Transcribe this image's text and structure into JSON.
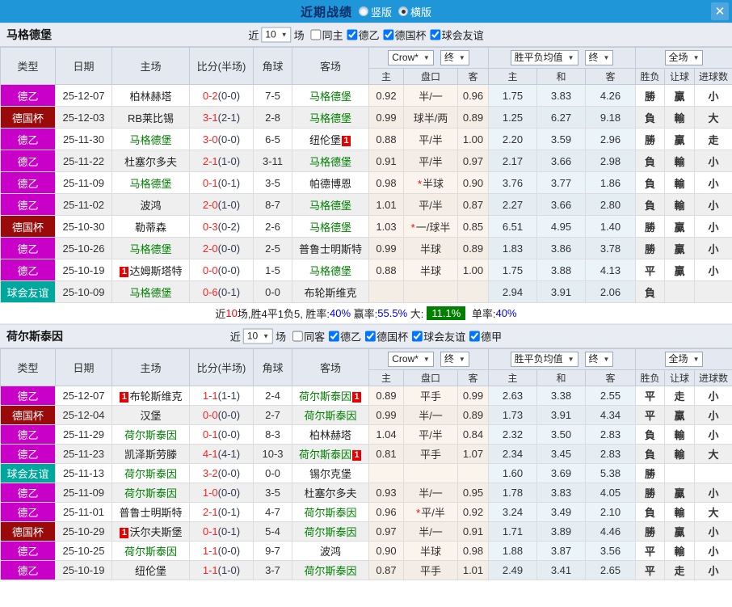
{
  "titlebar": {
    "title": "近期战绩",
    "radios": [
      {
        "label": "竖版",
        "checked": false
      },
      {
        "label": "横版",
        "checked": true
      }
    ]
  },
  "icons": {
    "close": "✕",
    "dropdown_arrow": "▼",
    "rank_badge": "1"
  },
  "table_header": {
    "type": "类型",
    "date": "日期",
    "home": "主场",
    "score": "比分(半场)",
    "corner": "角球",
    "away": "客场",
    "odds_source": "Crow*",
    "odds_period": "终",
    "avg_source": "胜平负均值",
    "avg_period": "终",
    "result_scope": "全场",
    "odds_home": "主",
    "odds_handicap": "盘口",
    "odds_away": "客",
    "avg_home": "主",
    "avg_draw": "和",
    "avg_away": "客",
    "result_wl": "胜负",
    "result_handicap": "让球",
    "result_goals": "进球数"
  },
  "colors": {
    "league_de2": "#C800C8",
    "cup": "#9A0A0A",
    "friendly": "#00A79C",
    "self_team": "#008000",
    "win": "#D40000",
    "lose": "#007A00",
    "draw": "#1414CC",
    "score_red": "#FF2222",
    "summary_highlight_bg": "#008000",
    "titlebar_blue": "#1E96D8"
  },
  "sections": [
    {
      "team": "马格德堡",
      "filter": {
        "prefix": "近",
        "count": "10",
        "suffix": "场",
        "checkboxes": [
          {
            "label": "同主",
            "checked": false
          },
          {
            "label": "德乙",
            "checked": true
          },
          {
            "label": "德国杯",
            "checked": true
          },
          {
            "label": "球会友谊",
            "checked": true
          }
        ]
      },
      "rows": [
        {
          "type": "德乙",
          "tc": "league",
          "date": "25-12-07",
          "home": "柏林赫塔",
          "score": "0-2",
          "half": "(0-0)",
          "corner": "7-5",
          "away": "马格德堡",
          "as": true,
          "h": "0.92",
          "hcap": "半/一",
          "a": "0.96",
          "m1": "1.75",
          "m2": "3.83",
          "m3": "4.26",
          "wl": "勝",
          "wlc": "r",
          "rg": "贏",
          "rgc": "r",
          "big": "小",
          "bigc": "g"
        },
        {
          "type": "德国杯",
          "tc": "cup",
          "date": "25-12-03",
          "home": "RB莱比锡",
          "score": "3-1",
          "half": "(2-1)",
          "corner": "2-8",
          "away": "马格德堡",
          "as": true,
          "h": "0.99",
          "hcap": "球半/两",
          "a": "0.89",
          "m1": "1.25",
          "m2": "6.27",
          "m3": "9.18",
          "wl": "負",
          "wlc": "g",
          "rg": "輸",
          "rgc": "g",
          "big": "大",
          "bigc": "r"
        },
        {
          "type": "德乙",
          "tc": "league",
          "date": "25-11-30",
          "home": "马格德堡",
          "hs": true,
          "score": "3-0",
          "half": "(0-0)",
          "corner": "6-5",
          "away": "纽伦堡",
          "ab": "1",
          "h": "0.88",
          "hcap": "平/半",
          "a": "1.00",
          "m1": "2.20",
          "m2": "3.59",
          "m3": "2.96",
          "wl": "勝",
          "wlc": "r",
          "rg": "贏",
          "rgc": "r",
          "big": "走",
          "bigc": "b"
        },
        {
          "type": "德乙",
          "tc": "league",
          "date": "25-11-22",
          "home": "杜塞尔多夫",
          "score": "2-1",
          "half": "(1-0)",
          "corner": "3-11",
          "away": "马格德堡",
          "as": true,
          "h": "0.91",
          "hcap": "平/半",
          "a": "0.97",
          "m1": "2.17",
          "m2": "3.66",
          "m3": "2.98",
          "wl": "負",
          "wlc": "g",
          "rg": "輸",
          "rgc": "g",
          "big": "小",
          "bigc": "g"
        },
        {
          "type": "德乙",
          "tc": "league",
          "date": "25-11-09",
          "home": "马格德堡",
          "hs": true,
          "score": "0-1",
          "half": "(0-1)",
          "corner": "3-5",
          "away": "帕德博恩",
          "h": "0.98",
          "hcap": "半球",
          "star": true,
          "a": "0.90",
          "m1": "3.76",
          "m2": "3.77",
          "m3": "1.86",
          "wl": "負",
          "wlc": "g",
          "rg": "輸",
          "rgc": "g",
          "big": "小",
          "bigc": "g"
        },
        {
          "type": "德乙",
          "tc": "league",
          "date": "25-11-02",
          "home": "波鸿",
          "score": "2-0",
          "half": "(1-0)",
          "corner": "8-7",
          "away": "马格德堡",
          "as": true,
          "h": "1.01",
          "hcap": "平/半",
          "a": "0.87",
          "m1": "2.27",
          "m2": "3.66",
          "m3": "2.80",
          "wl": "負",
          "wlc": "g",
          "rg": "輸",
          "rgc": "g",
          "big": "小",
          "bigc": "g"
        },
        {
          "type": "德国杯",
          "tc": "cup",
          "date": "25-10-30",
          "home": "勒蒂森",
          "score": "0-3",
          "half": "(0-2)",
          "corner": "2-6",
          "away": "马格德堡",
          "as": true,
          "h": "1.03",
          "hcap": "一/球半",
          "star": true,
          "a": "0.85",
          "m1": "6.51",
          "m2": "4.95",
          "m3": "1.40",
          "wl": "勝",
          "wlc": "r",
          "rg": "贏",
          "rgc": "r",
          "big": "小",
          "bigc": "g"
        },
        {
          "type": "德乙",
          "tc": "league",
          "date": "25-10-26",
          "home": "马格德堡",
          "hs": true,
          "score": "2-0",
          "half": "(0-0)",
          "corner": "2-5",
          "away": "普鲁士明斯特",
          "h": "0.99",
          "hcap": "半球",
          "a": "0.89",
          "m1": "1.83",
          "m2": "3.86",
          "m3": "3.78",
          "wl": "勝",
          "wlc": "r",
          "rg": "贏",
          "rgc": "r",
          "big": "小",
          "bigc": "g"
        },
        {
          "type": "德乙",
          "tc": "league",
          "date": "25-10-19",
          "home": "达姆斯塔特",
          "hb": "1",
          "score": "0-0",
          "half": "(0-0)",
          "corner": "1-5",
          "away": "马格德堡",
          "as": true,
          "h": "0.88",
          "hcap": "半球",
          "a": "1.00",
          "m1": "1.75",
          "m2": "3.88",
          "m3": "4.13",
          "wl": "平",
          "wlc": "b",
          "rg": "贏",
          "rgc": "r",
          "big": "小",
          "bigc": "g"
        },
        {
          "type": "球会友谊",
          "tc": "friendly",
          "date": "25-10-09",
          "home": "马格德堡",
          "hs": true,
          "score": "0-6",
          "half": "(0-1)",
          "corner": "0-0",
          "away": "布轮斯维克",
          "h": "",
          "hcap": "",
          "a": "",
          "m1": "2.94",
          "m2": "3.91",
          "m3": "2.06",
          "wl": "負",
          "wlc": "g",
          "rg": "",
          "big": ""
        }
      ],
      "summary": {
        "s1": "近",
        "count": "10",
        "s2": "场,胜4平1负5, 胜率:",
        "win_rate": "40%",
        "s3": " 赢率:",
        "odds_rate": "55.5%",
        "s4": " 大:",
        "big_rate": "11.1%",
        "s5": " 单率:",
        "single_rate": "40%"
      }
    },
    {
      "team": "荷尔斯泰因",
      "filter": {
        "prefix": "近",
        "count": "10",
        "suffix": "场",
        "checkboxes": [
          {
            "label": "同客",
            "checked": false
          },
          {
            "label": "德乙",
            "checked": true
          },
          {
            "label": "德国杯",
            "checked": true
          },
          {
            "label": "球会友谊",
            "checked": true
          },
          {
            "label": "德甲",
            "checked": true
          }
        ]
      },
      "rows": [
        {
          "type": "德乙",
          "tc": "league",
          "date": "25-12-07",
          "home": "布轮斯维克",
          "hb": "1",
          "score": "1-1",
          "half": "(1-1)",
          "corner": "2-4",
          "away": "荷尔斯泰因",
          "as": true,
          "ab": "1",
          "h": "0.89",
          "hcap": "平手",
          "a": "0.99",
          "m1": "2.63",
          "m2": "3.38",
          "m3": "2.55",
          "wl": "平",
          "wlc": "b",
          "rg": "走",
          "rgc": "b",
          "big": "小",
          "bigc": "g"
        },
        {
          "type": "德国杯",
          "tc": "cup",
          "date": "25-12-04",
          "home": "汉堡",
          "score": "0-0",
          "half": "(0-0)",
          "corner": "2-7",
          "away": "荷尔斯泰因",
          "as": true,
          "h": "0.99",
          "hcap": "半/一",
          "a": "0.89",
          "m1": "1.73",
          "m2": "3.91",
          "m3": "4.34",
          "wl": "平",
          "wlc": "b",
          "rg": "贏",
          "rgc": "r",
          "big": "小",
          "bigc": "g"
        },
        {
          "type": "德乙",
          "tc": "league",
          "date": "25-11-29",
          "home": "荷尔斯泰因",
          "hs": true,
          "score": "0-1",
          "half": "(0-0)",
          "corner": "8-3",
          "away": "柏林赫塔",
          "h": "1.04",
          "hcap": "平/半",
          "a": "0.84",
          "m1": "2.32",
          "m2": "3.50",
          "m3": "2.83",
          "wl": "負",
          "wlc": "g",
          "rg": "輸",
          "rgc": "g",
          "big": "小",
          "bigc": "g"
        },
        {
          "type": "德乙",
          "tc": "league",
          "date": "25-11-23",
          "home": "凯泽斯劳滕",
          "score": "4-1",
          "half": "(4-1)",
          "corner": "10-3",
          "away": "荷尔斯泰因",
          "as": true,
          "ab": "1",
          "h": "0.81",
          "hcap": "平手",
          "a": "1.07",
          "m1": "2.34",
          "m2": "3.45",
          "m3": "2.83",
          "wl": "負",
          "wlc": "g",
          "rg": "輸",
          "rgc": "g",
          "big": "大",
          "bigc": "r"
        },
        {
          "type": "球会友谊",
          "tc": "friendly",
          "date": "25-11-13",
          "home": "荷尔斯泰因",
          "hs": true,
          "score": "3-2",
          "half": "(0-0)",
          "corner": "0-0",
          "away": "锡尔克堡",
          "h": "",
          "hcap": "",
          "a": "",
          "m1": "1.60",
          "m2": "3.69",
          "m3": "5.38",
          "wl": "勝",
          "wlc": "r",
          "rg": "",
          "big": ""
        },
        {
          "type": "德乙",
          "tc": "league",
          "date": "25-11-09",
          "home": "荷尔斯泰因",
          "hs": true,
          "score": "1-0",
          "half": "(0-0)",
          "corner": "3-5",
          "away": "杜塞尔多夫",
          "h": "0.93",
          "hcap": "半/一",
          "a": "0.95",
          "m1": "1.78",
          "m2": "3.83",
          "m3": "4.05",
          "wl": "勝",
          "wlc": "r",
          "rg": "贏",
          "rgc": "r",
          "big": "小",
          "bigc": "g"
        },
        {
          "type": "德乙",
          "tc": "league",
          "date": "25-11-01",
          "home": "普鲁士明斯特",
          "score": "2-1",
          "half": "(0-1)",
          "corner": "4-7",
          "away": "荷尔斯泰因",
          "as": true,
          "h": "0.96",
          "hcap": "平/半",
          "star": true,
          "a": "0.92",
          "m1": "3.24",
          "m2": "3.49",
          "m3": "2.10",
          "wl": "負",
          "wlc": "g",
          "rg": "輸",
          "rgc": "g",
          "big": "大",
          "bigc": "r"
        },
        {
          "type": "德国杯",
          "tc": "cup",
          "date": "25-10-29",
          "home": "沃尔夫斯堡",
          "hb": "1",
          "score": "0-1",
          "half": "(0-1)",
          "corner": "5-4",
          "away": "荷尔斯泰因",
          "as": true,
          "h": "0.97",
          "hcap": "半/一",
          "a": "0.91",
          "m1": "1.71",
          "m2": "3.89",
          "m3": "4.46",
          "wl": "勝",
          "wlc": "r",
          "rg": "贏",
          "rgc": "r",
          "big": "小",
          "bigc": "g"
        },
        {
          "type": "德乙",
          "tc": "league",
          "date": "25-10-25",
          "home": "荷尔斯泰因",
          "hs": true,
          "score": "1-1",
          "half": "(0-0)",
          "corner": "9-7",
          "away": "波鸿",
          "h": "0.90",
          "hcap": "半球",
          "a": "0.98",
          "m1": "1.88",
          "m2": "3.87",
          "m3": "3.56",
          "wl": "平",
          "wlc": "b",
          "rg": "輸",
          "rgc": "g",
          "big": "小",
          "bigc": "g"
        },
        {
          "type": "德乙",
          "tc": "league",
          "date": "25-10-19",
          "home": "纽伦堡",
          "score": "1-1",
          "half": "(1-0)",
          "corner": "3-7",
          "away": "荷尔斯泰因",
          "as": true,
          "h": "0.87",
          "hcap": "平手",
          "a": "1.01",
          "m1": "2.49",
          "m2": "3.41",
          "m3": "2.65",
          "wl": "平",
          "wlc": "b",
          "rg": "走",
          "rgc": "b",
          "big": "小",
          "bigc": "g"
        }
      ],
      "summary": null
    }
  ]
}
